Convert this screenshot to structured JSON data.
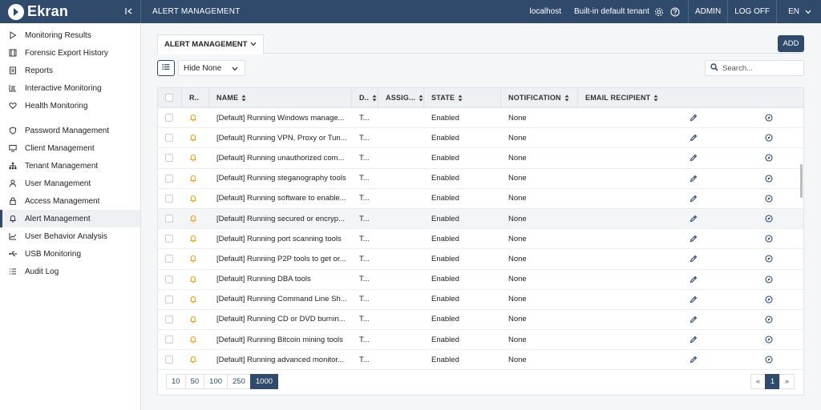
{
  "app": {
    "logo_text": "Ekran",
    "page_title": "ALERT MANAGEMENT"
  },
  "topbar": {
    "host": "localhost",
    "tenant": "Built-in default tenant",
    "user": "ADMIN",
    "logoff": "LOG OFF",
    "lang": "EN"
  },
  "sidebar": {
    "group1": [
      {
        "label": "Monitoring Results",
        "icon": "play-icon"
      },
      {
        "label": "Forensic Export History",
        "icon": "film-icon"
      },
      {
        "label": "Reports",
        "icon": "document-icon"
      },
      {
        "label": "Interactive Monitoring",
        "icon": "chart-icon"
      },
      {
        "label": "Health Monitoring",
        "icon": "heart-icon"
      }
    ],
    "group2": [
      {
        "label": "Password Management",
        "icon": "shield-icon"
      },
      {
        "label": "Client Management",
        "icon": "monitor-icon"
      },
      {
        "label": "Tenant Management",
        "icon": "hierarchy-icon"
      },
      {
        "label": "User Management",
        "icon": "user-icon"
      },
      {
        "label": "Access Management",
        "icon": "lock-icon"
      },
      {
        "label": "Alert Management",
        "icon": "bell-icon",
        "active": true
      },
      {
        "label": "User Behavior Analysis",
        "icon": "trend-icon"
      },
      {
        "label": "USB Monitoring",
        "icon": "usb-icon"
      },
      {
        "label": "Audit Log",
        "icon": "list-icon"
      }
    ]
  },
  "toolbar": {
    "tab_label": "ALERT MANAGEMENT",
    "add_label": "ADD",
    "hide_value": "Hide None",
    "search_placeholder": "Search..."
  },
  "table": {
    "headers": [
      "R..",
      "NAME",
      "D..",
      "ASSIG...",
      "STATE",
      "NOTIFICATION",
      "EMAIL RECIPIENT"
    ],
    "rows": [
      {
        "name": "[Default] Running Windows manage...",
        "d": "T...",
        "state": "Enabled",
        "notification": "None"
      },
      {
        "name": "[Default] Running VPN, Proxy or Tun...",
        "d": "T...",
        "state": "Enabled",
        "notification": "None"
      },
      {
        "name": "[Default] Running unauthorized com...",
        "d": "T...",
        "state": "Enabled",
        "notification": "None"
      },
      {
        "name": "[Default] Running steganography tools",
        "d": "T...",
        "state": "Enabled",
        "notification": "None"
      },
      {
        "name": "[Default] Running software to enable...",
        "d": "T...",
        "state": "Enabled",
        "notification": "None"
      },
      {
        "name": "[Default] Running secured or encryp...",
        "d": "T...",
        "state": "Enabled",
        "notification": "None"
      },
      {
        "name": "[Default] Running port scanning tools",
        "d": "T...",
        "state": "Enabled",
        "notification": "None"
      },
      {
        "name": "[Default] Running P2P tools to get or...",
        "d": "T...",
        "state": "Enabled",
        "notification": "None"
      },
      {
        "name": "[Default] Running DBA tools",
        "d": "T...",
        "state": "Enabled",
        "notification": "None"
      },
      {
        "name": "[Default] Running Command Line Sh...",
        "d": "T...",
        "state": "Enabled",
        "notification": "None"
      },
      {
        "name": "[Default] Running CD or DVD burnin...",
        "d": "T...",
        "state": "Enabled",
        "notification": "None"
      },
      {
        "name": "[Default] Running Bitcoin mining tools",
        "d": "T...",
        "state": "Enabled",
        "notification": "None"
      },
      {
        "name": "[Default] Running advanced monitor...",
        "d": "T...",
        "state": "Enabled",
        "notification": "None"
      }
    ]
  },
  "pagination": {
    "sizes": [
      "10",
      "50",
      "100",
      "250",
      "1000"
    ],
    "active_size": "1000",
    "prev": "«",
    "page": "1",
    "next": "»"
  },
  "colors": {
    "primary": "#2f4a6b",
    "bell": "#f0a020"
  }
}
